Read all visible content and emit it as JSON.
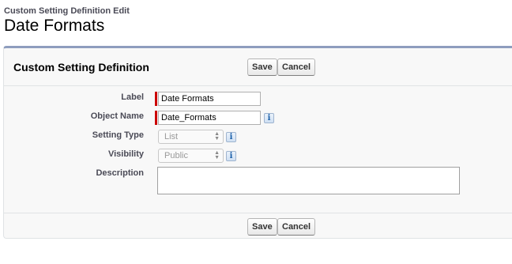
{
  "header": {
    "breadcrumb": "Custom Setting Definition Edit",
    "title": "Date Formats"
  },
  "block": {
    "title": "Custom Setting Definition",
    "save_label": "Save",
    "cancel_label": "Cancel"
  },
  "form": {
    "label_field": {
      "label": "Label",
      "value": "Date Formats",
      "required": true
    },
    "object_name_field": {
      "label": "Object Name",
      "value": "Date_Formats",
      "required": true,
      "info_icon": "i"
    },
    "setting_type_field": {
      "label": "Setting Type",
      "value": "List",
      "disabled": true,
      "info_icon": "i"
    },
    "visibility_field": {
      "label": "Visibility",
      "value": "Public",
      "disabled": true,
      "info_icon": "i"
    },
    "description_field": {
      "label": "Description",
      "value": ""
    }
  },
  "footer": {
    "save_label": "Save",
    "cancel_label": "Cancel"
  },
  "colors": {
    "required_marker": "#cc0000",
    "block_top_border": "#8e9dbe",
    "label_text": "#4a4a56"
  }
}
